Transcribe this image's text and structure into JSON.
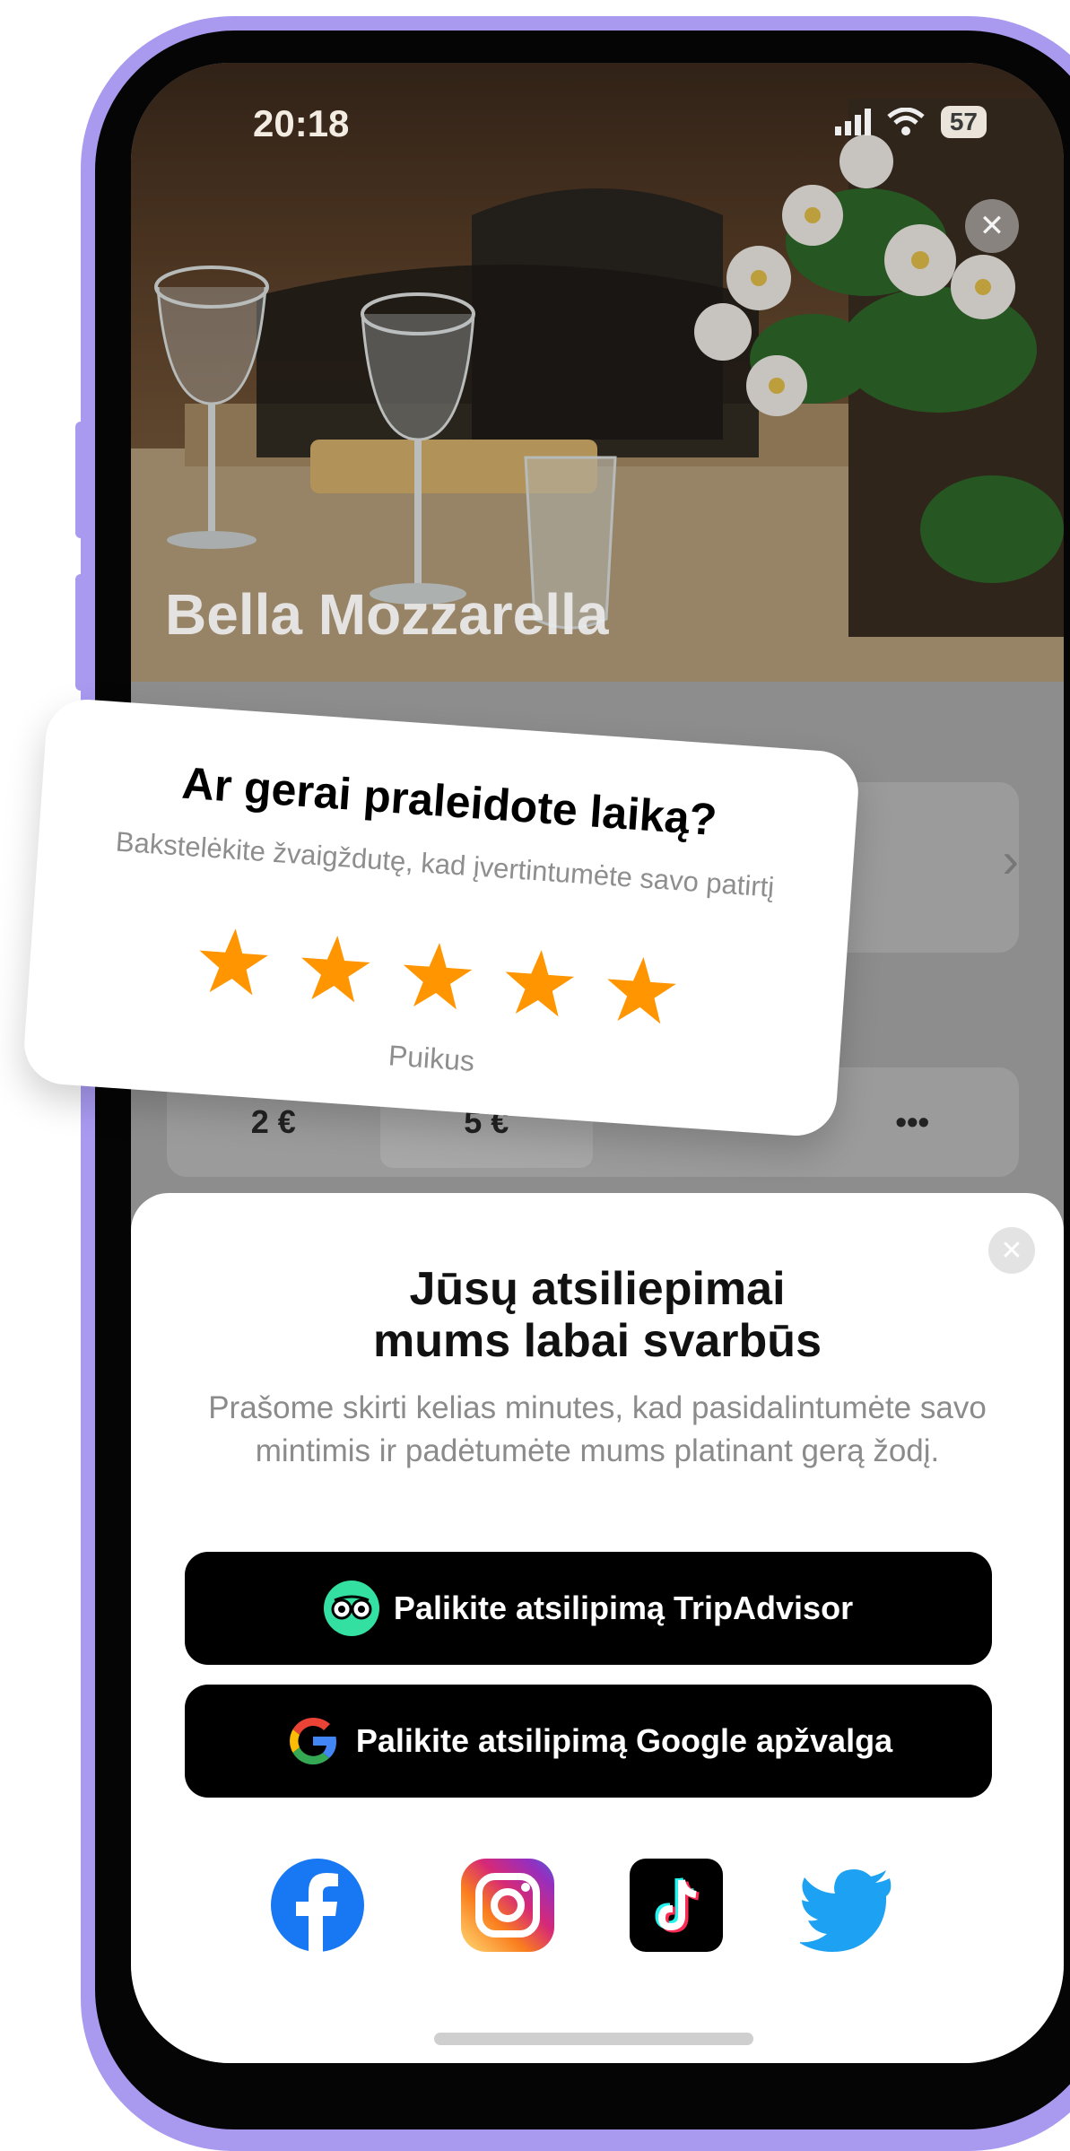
{
  "status_bar": {
    "time": "20:18",
    "battery": "57"
  },
  "hero": {
    "restaurant_name": "Bella Mozzarella",
    "close_icon": "close-icon"
  },
  "background": {
    "tips": [
      "2 €",
      "5 €",
      "",
      "•••"
    ]
  },
  "rating_card": {
    "title": "Ar gerai praleidote laiką?",
    "subtitle": "Bakstelėkite žvaigždutę, kad įvertintumėte savo patirtį",
    "stars": 5,
    "star_color": "#FF9500",
    "label": "Puikus"
  },
  "feedback_sheet": {
    "title": "Jūsų atsiliepimai mums labai svarbūs",
    "description": "Prašome skirti kelias minutes, kad pasidalintumėte savo mintimis ir padėtumėte mums platinant gerą žodį.",
    "tripadvisor_button": "Palikite atsilipimą TripAdvisor",
    "google_button": "Palikite atsilipimą Google apžvalga",
    "socials": [
      "facebook-icon",
      "instagram-icon",
      "tiktok-icon",
      "twitter-icon"
    ]
  },
  "colors": {
    "frame": "#A99AF0",
    "tripadvisor": "#34E0A1",
    "facebook": "#1877F2",
    "twitter": "#1DA1F2"
  }
}
